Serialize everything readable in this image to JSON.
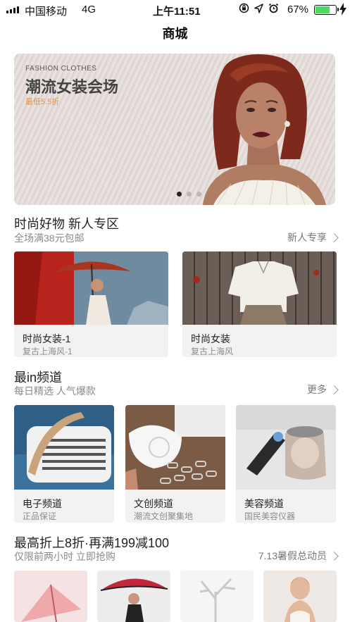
{
  "status_bar": {
    "carrier": "中国移动",
    "network": "4G",
    "time": "上午11:51",
    "battery_percent": "67%",
    "battery_level": 0.67,
    "icons": [
      "orientation-lock-icon",
      "location-arrow-icon",
      "alarm-icon",
      "battery-icon",
      "charging-bolt-icon"
    ]
  },
  "nav": {
    "title": "商城"
  },
  "banner": {
    "subtitle": "FASHION CLOTHES",
    "title": "潮流女装会场",
    "discount": "最低5.5折",
    "active_slide": 1,
    "slide_count": 3
  },
  "section1": {
    "title": "时尚好物 新人专区",
    "subtitle": "全场满38元包邮",
    "link": "新人专享",
    "cards": [
      {
        "label": "时尚女装-1",
        "sublabel": "复古上海风-1"
      },
      {
        "label": "时尚女装",
        "sublabel": "复古上海风"
      }
    ]
  },
  "section2": {
    "title": "最in频道",
    "subtitle": "每日精选 人气爆款",
    "link": "更多",
    "cards": [
      {
        "label": "电子频道",
        "sublabel": "正品保证"
      },
      {
        "label": "文创频道",
        "sublabel": "潮流文创聚集地"
      },
      {
        "label": "美容频道",
        "sublabel": "国民美容仪器"
      }
    ]
  },
  "section3": {
    "title": "最高折上8折·再满199减100",
    "subtitle": "仅限前两小时 立即抢购",
    "link": "7.13暑假总动员"
  },
  "colors": {
    "accent_orange": "#e0954a",
    "battery_green": "#4cd964",
    "card_bg": "#f2f2f2",
    "subtext": "#8a8a8a"
  }
}
